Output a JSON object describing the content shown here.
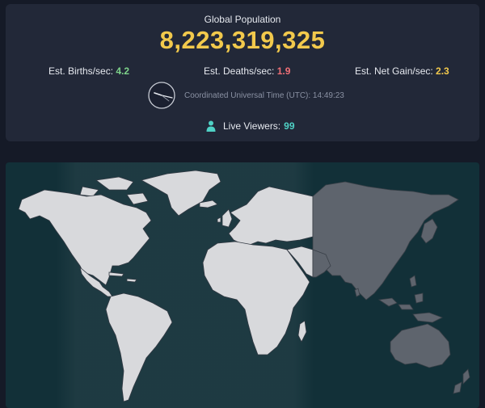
{
  "stats": {
    "title": "Global Population",
    "population": "8,223,319,325",
    "births_label": "Est. Births/sec:",
    "births_value": "4.2",
    "deaths_label": "Est. Deaths/sec:",
    "deaths_value": "1.9",
    "net_label": "Est. Net Gain/sec:",
    "net_value": "2.3",
    "utc_text": "Coordinated Universal Time (UTC): 14:49:23",
    "viewers_label": "Live Viewers:",
    "viewers_value": "99"
  },
  "colors": {
    "population": "#f2c94c",
    "births": "#7ed38a",
    "deaths": "#ef6f76",
    "net_gain": "#f2c94c",
    "viewers": "#4fd1c5",
    "land_day": "#d8d9dc",
    "land_night": "#5e646d",
    "ocean": "#123038"
  },
  "icons": {
    "clock": "analog-clock-icon",
    "viewers": "person-icon"
  }
}
